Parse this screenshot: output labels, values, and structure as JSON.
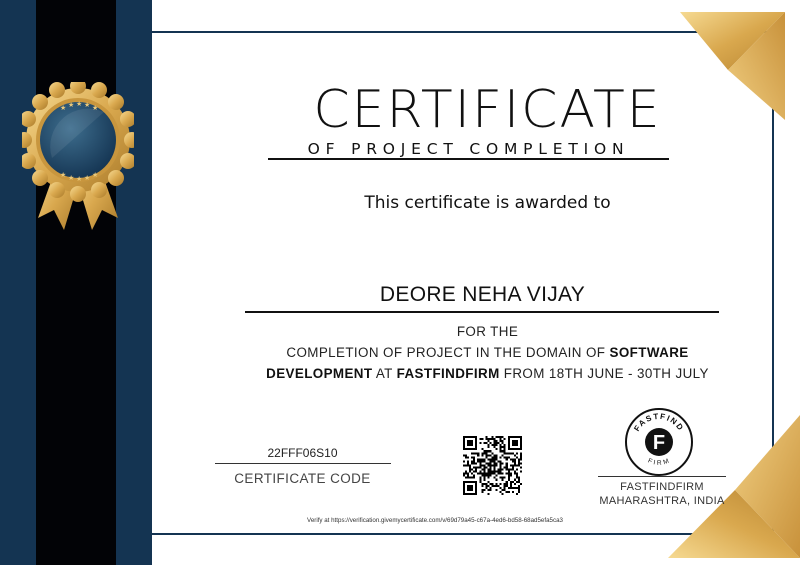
{
  "certificate": {
    "title": "CERTIFICATE",
    "subtitle": "OF PROJECT COMPLETION",
    "awarded_text": "This certificate is awarded to",
    "recipient_name": "DEORE NEHA VIJAY",
    "for_the": "FOR THE",
    "line2_pre": "COMPLETION OF PROJECT IN THE DOMAIN OF ",
    "line2_bold": "SOFTWARE",
    "line3_bold1": "DEVELOPMENT",
    "line3_mid1": " AT ",
    "line3_bold2": "FASTFINDFIRM",
    "line3_post": " FROM 18TH JUNE - 30TH JULY",
    "code_value": "22FFF06S10",
    "code_label": "CERTIFICATE CODE",
    "firm_name": "FASTFINDFIRM",
    "firm_location": "MAHARASHTRA, INDIA",
    "verify_text": "Verify at https://verification.givemycertificate.com/v/69d79a45-c67a-4ed6-bd58-68ad5efa5ca3"
  },
  "logo": {
    "ring_top": "FASTFIND",
    "ring_bottom": "FIRM",
    "letter": "F"
  },
  "icons": {
    "medal": "award-medal-icon",
    "qr": "qr-code-icon",
    "firm_logo": "fastfindfirm-logo"
  },
  "colors": {
    "navy": "#143452",
    "black_band": "#020306",
    "gold": "#D9A84E",
    "gold_light": "#F3D48A",
    "gold_dark": "#A97A2A"
  }
}
